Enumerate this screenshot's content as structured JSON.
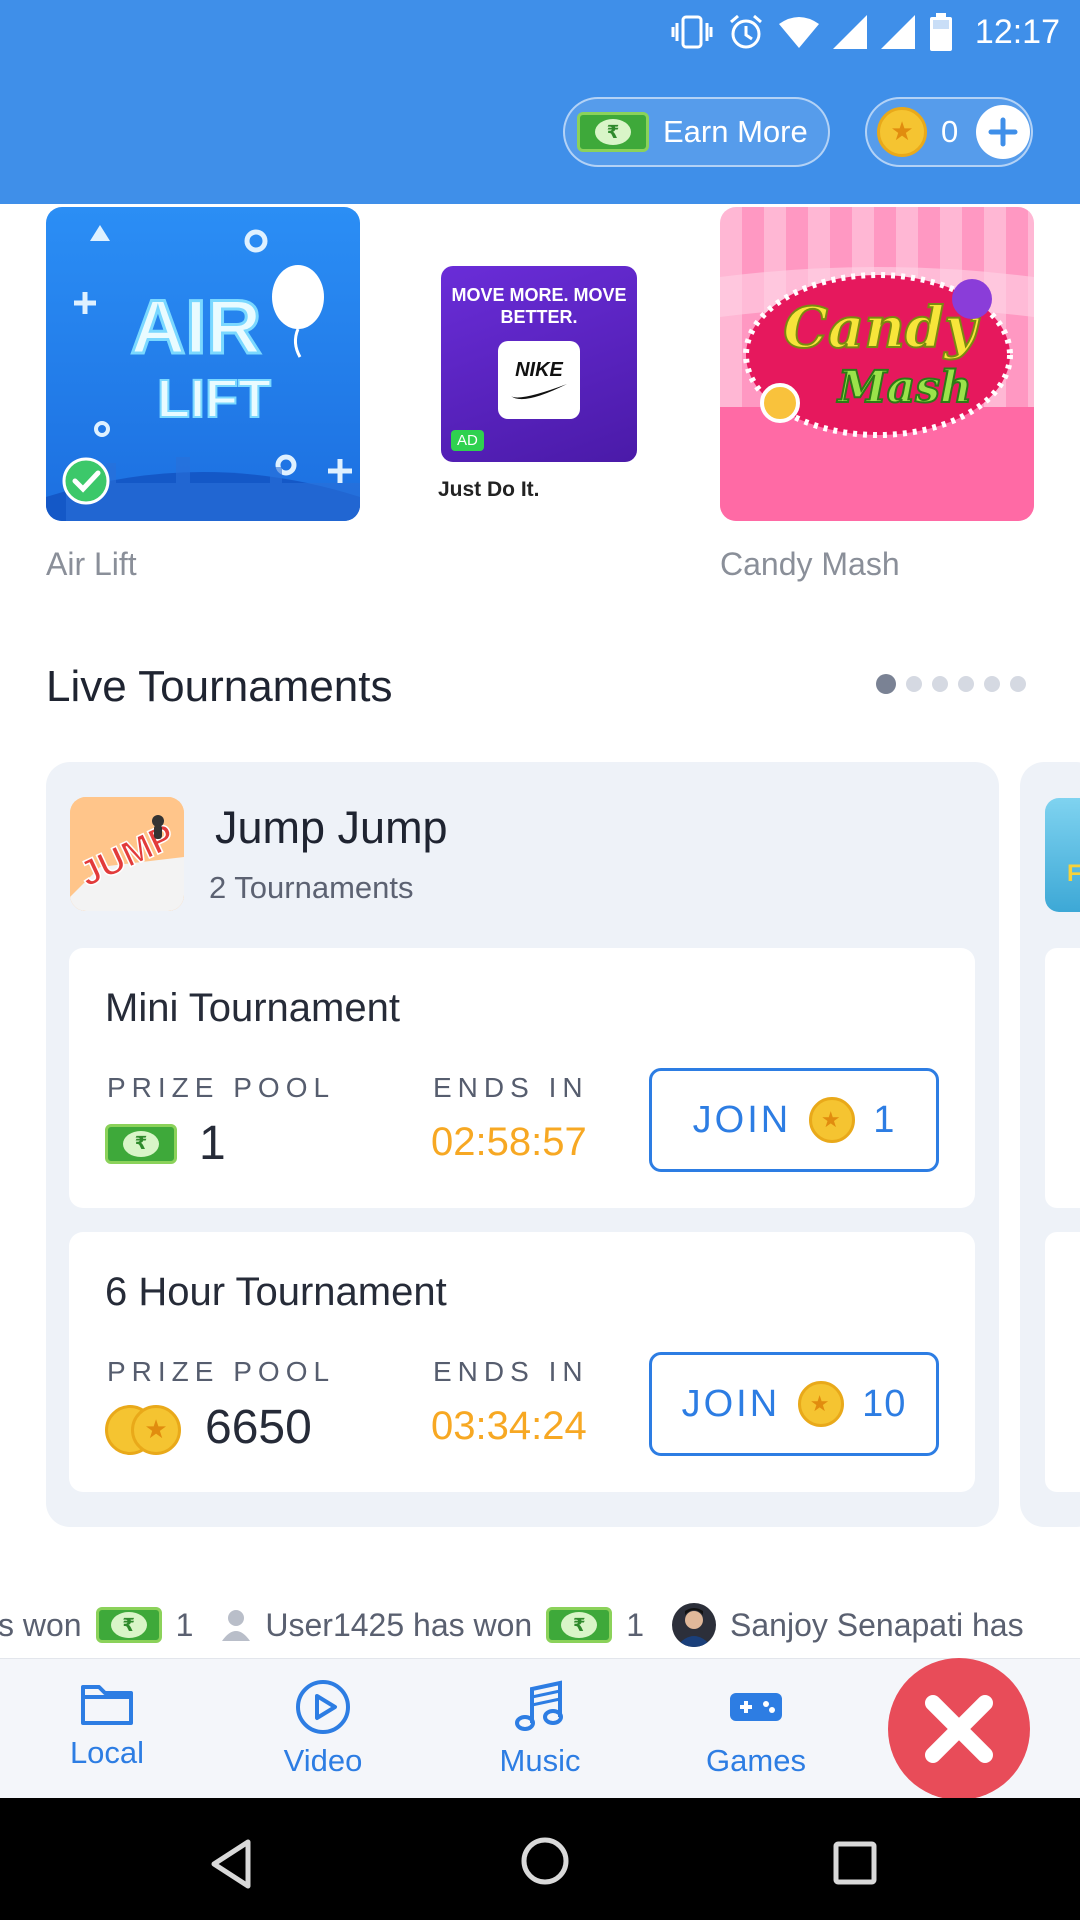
{
  "status_bar": {
    "time": "12:17"
  },
  "header": {
    "earn_label": "Earn More",
    "coin_count": "0"
  },
  "featured": [
    {
      "title": "Air Lift",
      "art_text_1": "AIR",
      "art_text_2": "LIFT"
    },
    {
      "headline": "MOVE MORE. MOVE BETTER.",
      "brand": "NIKE",
      "badge": "AD",
      "caption": "Just Do It."
    },
    {
      "title": "Candy Mash",
      "art_text_1": "Candy",
      "art_text_2": "Mash"
    }
  ],
  "live": {
    "title": "Live Tournaments",
    "game": {
      "name": "Jump Jump",
      "subtitle": "2 Tournaments",
      "art_text": "JUMP"
    },
    "tournaments": [
      {
        "name": "Mini Tournament",
        "prize_label": "PRIZE POOL",
        "prize": "1",
        "prize_type": "cash",
        "ends_label": "ENDS IN",
        "ends": "02:58:57",
        "join_label": "JOIN",
        "cost": "1"
      },
      {
        "name": "6 Hour Tournament",
        "prize_label": "PRIZE POOL",
        "prize": "6650",
        "prize_type": "coins",
        "ends_label": "ENDS IN",
        "ends": "03:34:24",
        "join_label": "JOIN",
        "cost": "10"
      }
    ],
    "peek_art_text": "FL"
  },
  "ticker": [
    {
      "text": "s won",
      "amount": "1"
    },
    {
      "text": "User1425 has won",
      "amount": "1"
    },
    {
      "text": "Sanjoy Senapati has"
    }
  ],
  "bottom_nav": [
    {
      "label": "Local",
      "icon": "folder-icon"
    },
    {
      "label": "Video",
      "icon": "play-circle-icon"
    },
    {
      "label": "Music",
      "icon": "music-note-icon"
    },
    {
      "label": "Games",
      "icon": "gamepad-icon"
    }
  ],
  "colors": {
    "header": "#3f8fe9",
    "accent": "#2d7de3",
    "timer": "#f7a823",
    "close": "#e84c59"
  }
}
